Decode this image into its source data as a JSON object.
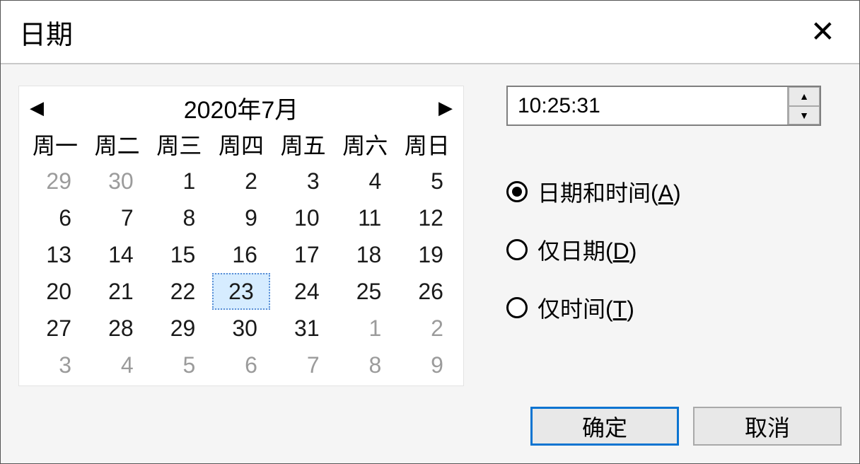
{
  "window": {
    "title": "日期",
    "close_glyph": "✕"
  },
  "calendar": {
    "title": "2020年7月",
    "prev_glyph": "◀",
    "next_glyph": "▶",
    "weekdays": [
      "周一",
      "周二",
      "周三",
      "周四",
      "周五",
      "周六",
      "周日"
    ],
    "days": [
      [
        {
          "d": "29",
          "o": true
        },
        {
          "d": "30",
          "o": true
        },
        {
          "d": "1"
        },
        {
          "d": "2"
        },
        {
          "d": "3"
        },
        {
          "d": "4"
        },
        {
          "d": "5"
        }
      ],
      [
        {
          "d": "6"
        },
        {
          "d": "7"
        },
        {
          "d": "8"
        },
        {
          "d": "9"
        },
        {
          "d": "10"
        },
        {
          "d": "11"
        },
        {
          "d": "12"
        }
      ],
      [
        {
          "d": "13"
        },
        {
          "d": "14"
        },
        {
          "d": "15"
        },
        {
          "d": "16"
        },
        {
          "d": "17"
        },
        {
          "d": "18"
        },
        {
          "d": "19"
        }
      ],
      [
        {
          "d": "20"
        },
        {
          "d": "21"
        },
        {
          "d": "22"
        },
        {
          "d": "23",
          "sel": true
        },
        {
          "d": "24"
        },
        {
          "d": "25"
        },
        {
          "d": "26"
        }
      ],
      [
        {
          "d": "27"
        },
        {
          "d": "28"
        },
        {
          "d": "29"
        },
        {
          "d": "30"
        },
        {
          "d": "31"
        },
        {
          "d": "1",
          "o": true
        },
        {
          "d": "2",
          "o": true
        }
      ],
      [
        {
          "d": "3",
          "o": true
        },
        {
          "d": "4",
          "o": true
        },
        {
          "d": "5",
          "o": true
        },
        {
          "d": "6",
          "o": true
        },
        {
          "d": "7",
          "o": true
        },
        {
          "d": "8",
          "o": true
        },
        {
          "d": "9",
          "o": true
        }
      ]
    ]
  },
  "time": {
    "value": "10:25:31",
    "up_glyph": "▲",
    "down_glyph": "▼"
  },
  "options": {
    "date_and_time": {
      "label": "日期和时间(",
      "key": "A",
      "tail": ")",
      "checked": true
    },
    "date_only": {
      "label": "仅日期(",
      "key": "D",
      "tail": ")",
      "checked": false
    },
    "time_only": {
      "label": "仅时间(",
      "key": "T",
      "tail": ")",
      "checked": false
    }
  },
  "buttons": {
    "ok": "确定",
    "cancel": "取消"
  }
}
